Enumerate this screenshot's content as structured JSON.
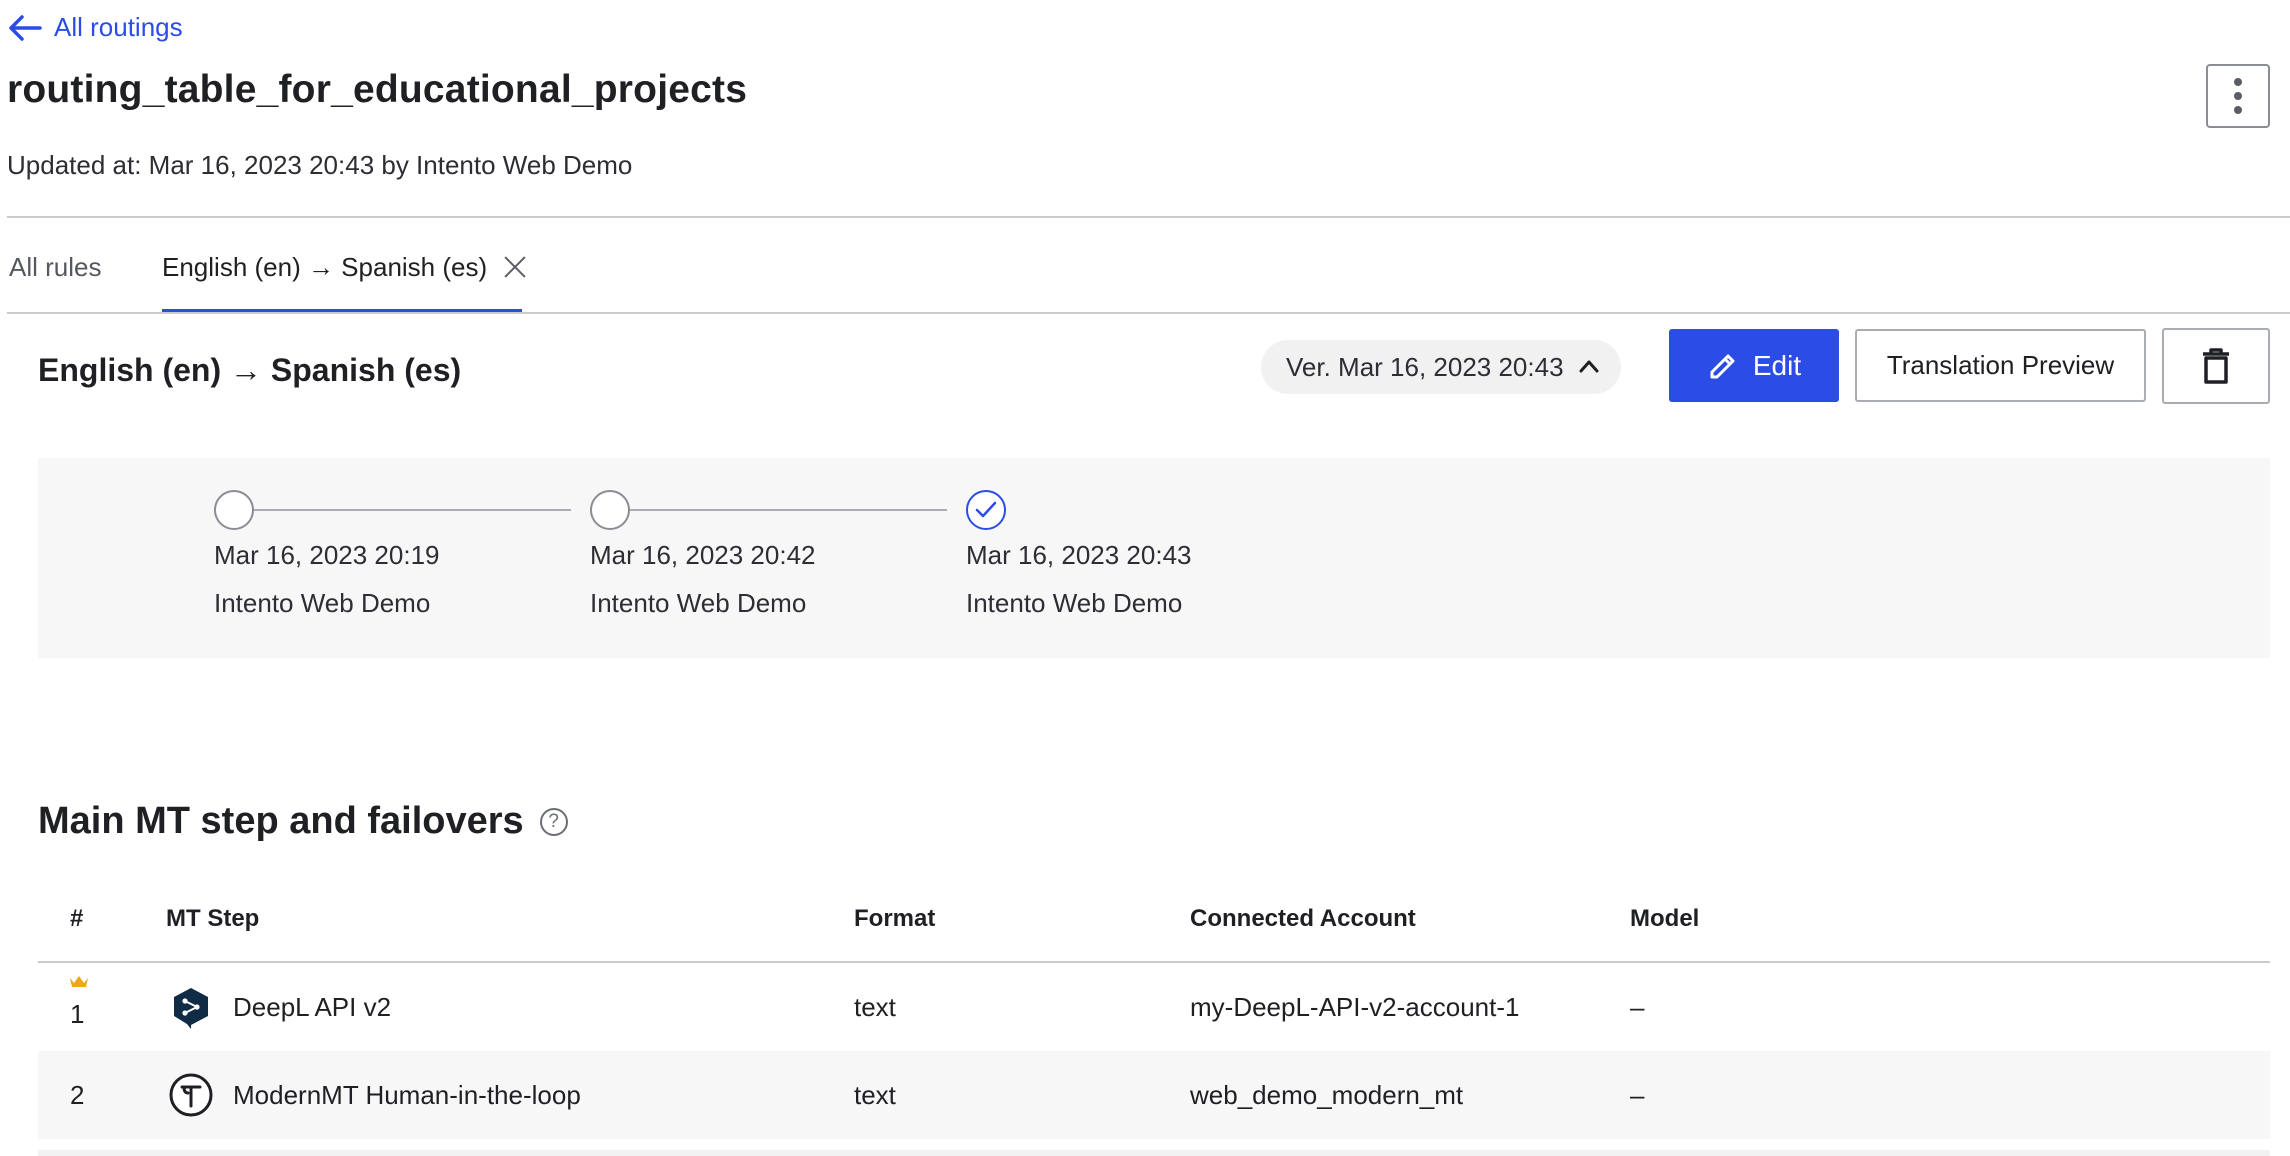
{
  "header": {
    "back_link": "All routings",
    "title": "routing_table_for_educational_projects",
    "updated": "Updated at: Mar 16, 2023 20:43 by Intento Web Demo"
  },
  "tabs": {
    "all_rules": "All rules",
    "active": "English (en) → Spanish (es)"
  },
  "rule": {
    "heading": "English (en) → Spanish (es)",
    "version": "Ver. Mar 16, 2023 20:43",
    "edit_label": "Edit",
    "preview_label": "Translation Preview"
  },
  "timeline": [
    {
      "date": "Mar 16, 2023 20:19",
      "user": "Intento Web Demo",
      "active": false
    },
    {
      "date": "Mar 16, 2023 20:42",
      "user": "Intento Web Demo",
      "active": false
    },
    {
      "date": "Mar 16, 2023 20:43",
      "user": "Intento Web Demo",
      "active": true
    }
  ],
  "mt_section": {
    "heading": "Main MT step and failovers",
    "columns": [
      "#",
      "MT Step",
      "Format",
      "Connected Account",
      "Model"
    ],
    "rows": [
      {
        "num": "1",
        "step": "DeepL API v2",
        "format": "text",
        "account": "my-DeepL-API-v2-account-1",
        "model": "–",
        "icon": "deepl-icon",
        "primary": true
      },
      {
        "num": "2",
        "step": "ModernMT Human-in-the-loop",
        "format": "text",
        "account": "web_demo_modern_mt",
        "model": "–",
        "icon": "modernmt-icon",
        "primary": false
      }
    ]
  },
  "colors": {
    "accent": "#2b4de6",
    "crown": "#f0a51a",
    "deepl": "#0f2b46"
  }
}
